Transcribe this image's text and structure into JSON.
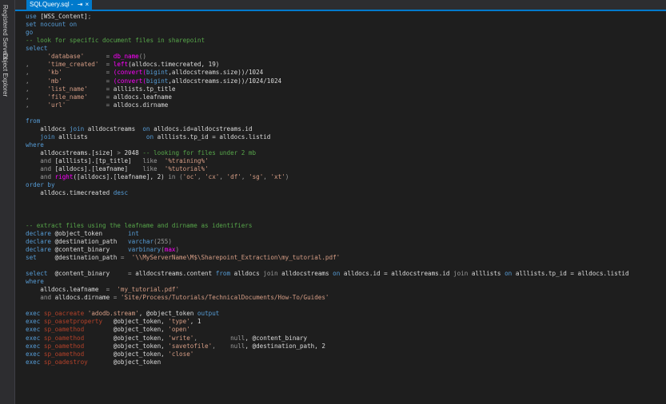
{
  "sidebar": {
    "registered_servers": "Registered Servers",
    "object_explorer": "Object Explorer"
  },
  "tab": {
    "title": "SQLQuery.sql - ",
    "pin": "⇥",
    "close": "×"
  },
  "code": {
    "l1": [
      "use",
      "[WSS_Content]",
      ";"
    ],
    "l2": [
      "set",
      "nocount",
      "on"
    ],
    "l3": [
      "go"
    ],
    "l4": [
      "-- look for specific document files in sharepoint"
    ],
    "l5": [
      "select"
    ],
    "l6": [
      "'database'",
      "=",
      "db_name",
      "()"
    ],
    "l7": [
      ",",
      "'time_created'",
      "=",
      "left",
      "(alldocs.timecreated, 19)"
    ],
    "l8": [
      ",",
      "'kb'",
      "=",
      "(convert(",
      "bigint",
      ",alldocstreams.size))/1024"
    ],
    "l9": [
      ",",
      "'mb'",
      "=",
      "(convert(",
      "bigint",
      ",alldocstreams.size))/1024/1024"
    ],
    "l10": [
      ",",
      "'list_name'",
      "=",
      "alllists.tp_title"
    ],
    "l11": [
      ",",
      "'file_name'",
      "=",
      "alldocs.leafname"
    ],
    "l12": [
      ",",
      "'url'",
      "=",
      "alldocs.dirname"
    ],
    "l13": [
      "from"
    ],
    "l14": [
      "alldocs",
      "join",
      "alldocstreams",
      "on",
      "alldocs.id=alldocstreams.id"
    ],
    "l15": [
      "join",
      "alllists",
      "on",
      "alllists.tp_id = alldocs.listid"
    ],
    "l16": [
      "where"
    ],
    "l17": [
      "alldocstreams.[size]",
      ">",
      "2048",
      "-- looking for files under 2 mb"
    ],
    "l18": [
      "and",
      "[alllists].[tp_title]",
      "like",
      "'%training%'"
    ],
    "l19": [
      "and",
      "[alldocs].[leafname]",
      "like",
      "'%tutorial%'"
    ],
    "l20": [
      "and",
      "right",
      "([alldocs].[leafname], 2)",
      "in",
      "(",
      "'oc'",
      ",",
      "'cx'",
      ",",
      "'df'",
      ",",
      "'sg'",
      ",",
      "'xt'",
      ")"
    ],
    "l21": [
      "order by"
    ],
    "l22": [
      "alldocs.timecreated",
      "desc"
    ],
    "l23": [
      "-- extract files using the leafname and dirname as identifiers"
    ],
    "l24": [
      "declare",
      "@object_token",
      "int"
    ],
    "l25": [
      "declare",
      "@destination_path",
      "varchar",
      "(255)"
    ],
    "l26": [
      "declare",
      "@content_binary",
      "varbinary",
      "(",
      "max",
      ")"
    ],
    "l27": [
      "set",
      "@destination_path",
      "=",
      "'\\\\MyServerName\\M$\\Sharepoint_Extraction\\my_tutorial.pdf'"
    ],
    "l28": [
      "select",
      "@content_binary",
      "=",
      "alldocstreams.content",
      "from",
      "alldocs",
      "join",
      "alldocstreams",
      "on",
      "alldocs.id = alldocstreams.id",
      "join",
      "alllists",
      "on",
      "alllists.tp_id = alldocs.listid"
    ],
    "l29": [
      "where"
    ],
    "l30": [
      "alldocs.leafname",
      "=",
      "'my_tutorial.pdf'"
    ],
    "l31": [
      "and",
      "alldocs.dirname",
      "=",
      "'Site/Process/Tutorials/TechnicalDocuments/How-To/Guides'"
    ],
    "l32": [
      "exec",
      "sp_oacreate",
      "'adodb.stream'",
      ", @object_token",
      "output"
    ],
    "l33": [
      "exec",
      "sp_oasetproperty",
      "@object_token,",
      "'type'",
      ", 1"
    ],
    "l34": [
      "exec",
      "sp_oamethod",
      "@object_token,",
      "'open'"
    ],
    "l35": [
      "exec",
      "sp_oamethod",
      "@object_token,",
      "'write'",
      ",",
      "null",
      ", @content_binary"
    ],
    "l36": [
      "exec",
      "sp_oamethod",
      "@object_token,",
      "'savetofile'",
      ",",
      "null",
      ", @destination_path, 2"
    ],
    "l37": [
      "exec",
      "sp_oamethod",
      "@object_token,",
      "'close'"
    ],
    "l38": [
      "exec",
      "sp_oadestroy",
      "@object_token"
    ]
  }
}
